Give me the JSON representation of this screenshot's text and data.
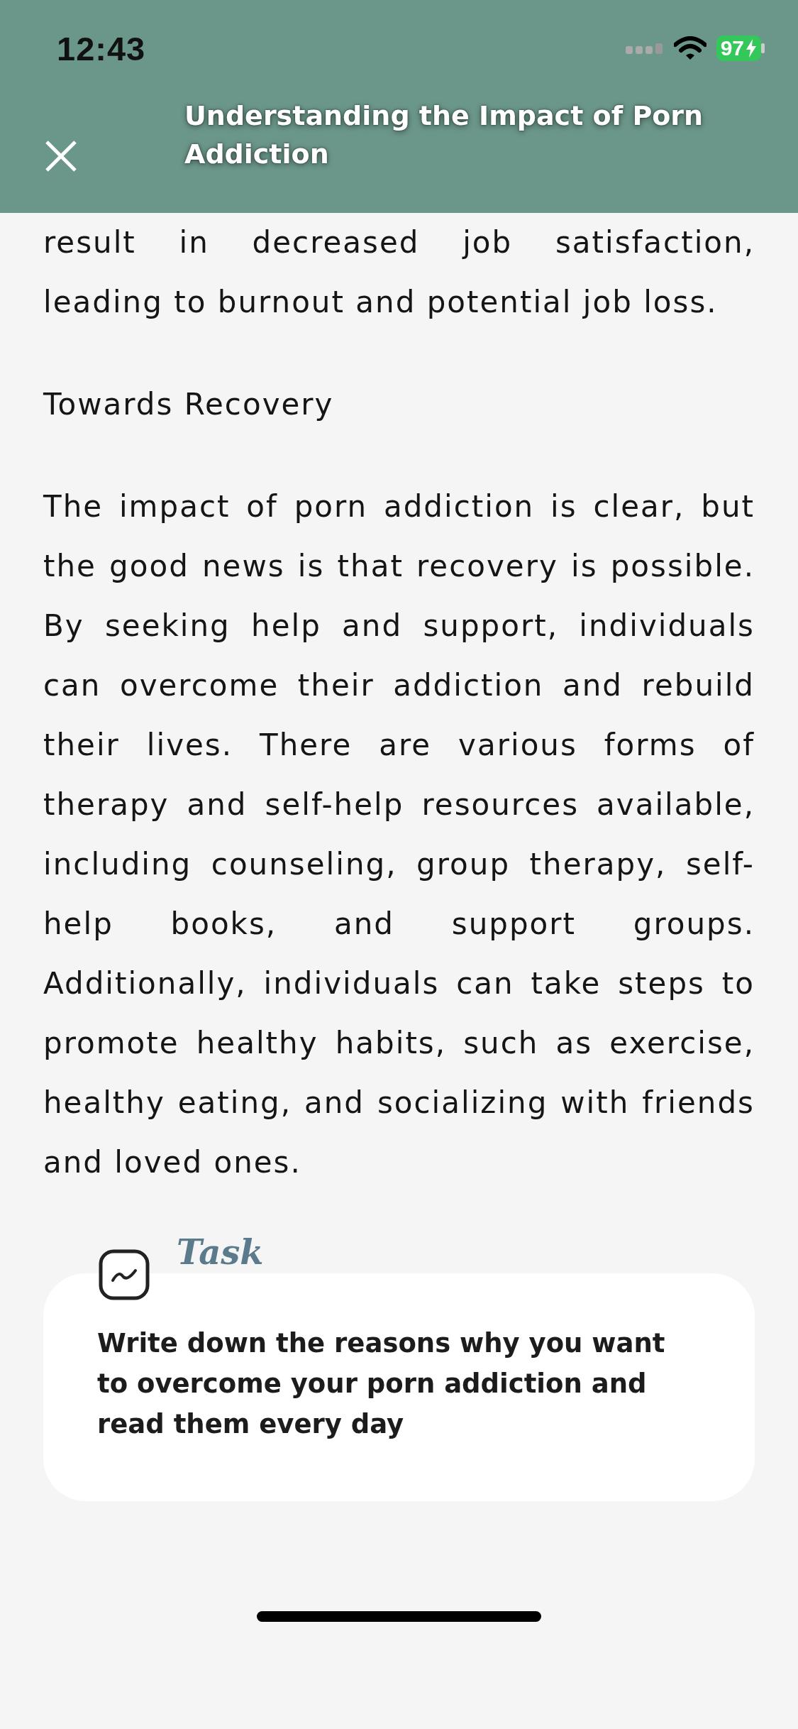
{
  "status_bar": {
    "time": "12:43",
    "battery": "97"
  },
  "header": {
    "title": "Understanding the Impact of Porn Addiction"
  },
  "article": [
    {
      "kind": "paragraph",
      "text": "result in decreased job satisfaction, leading to burnout and potential job loss."
    },
    {
      "kind": "heading",
      "text": "Towards Recovery"
    },
    {
      "kind": "paragraph",
      "text": "The impact of porn addiction is clear, but the good news is that recovery is possible. By seeking help and support, individuals can overcome their addiction and rebuild their lives. There are various forms of therapy and self-help resources available, including counseling, group therapy, self-help books, and support groups. Additionally, individuals can take steps to promote healthy habits, such as exercise, healthy eating, and socializing with friends and loved ones."
    }
  ],
  "task": {
    "label": "Task",
    "text": "Write down the reasons why you want to overcome your porn addiction and read them every day"
  }
}
